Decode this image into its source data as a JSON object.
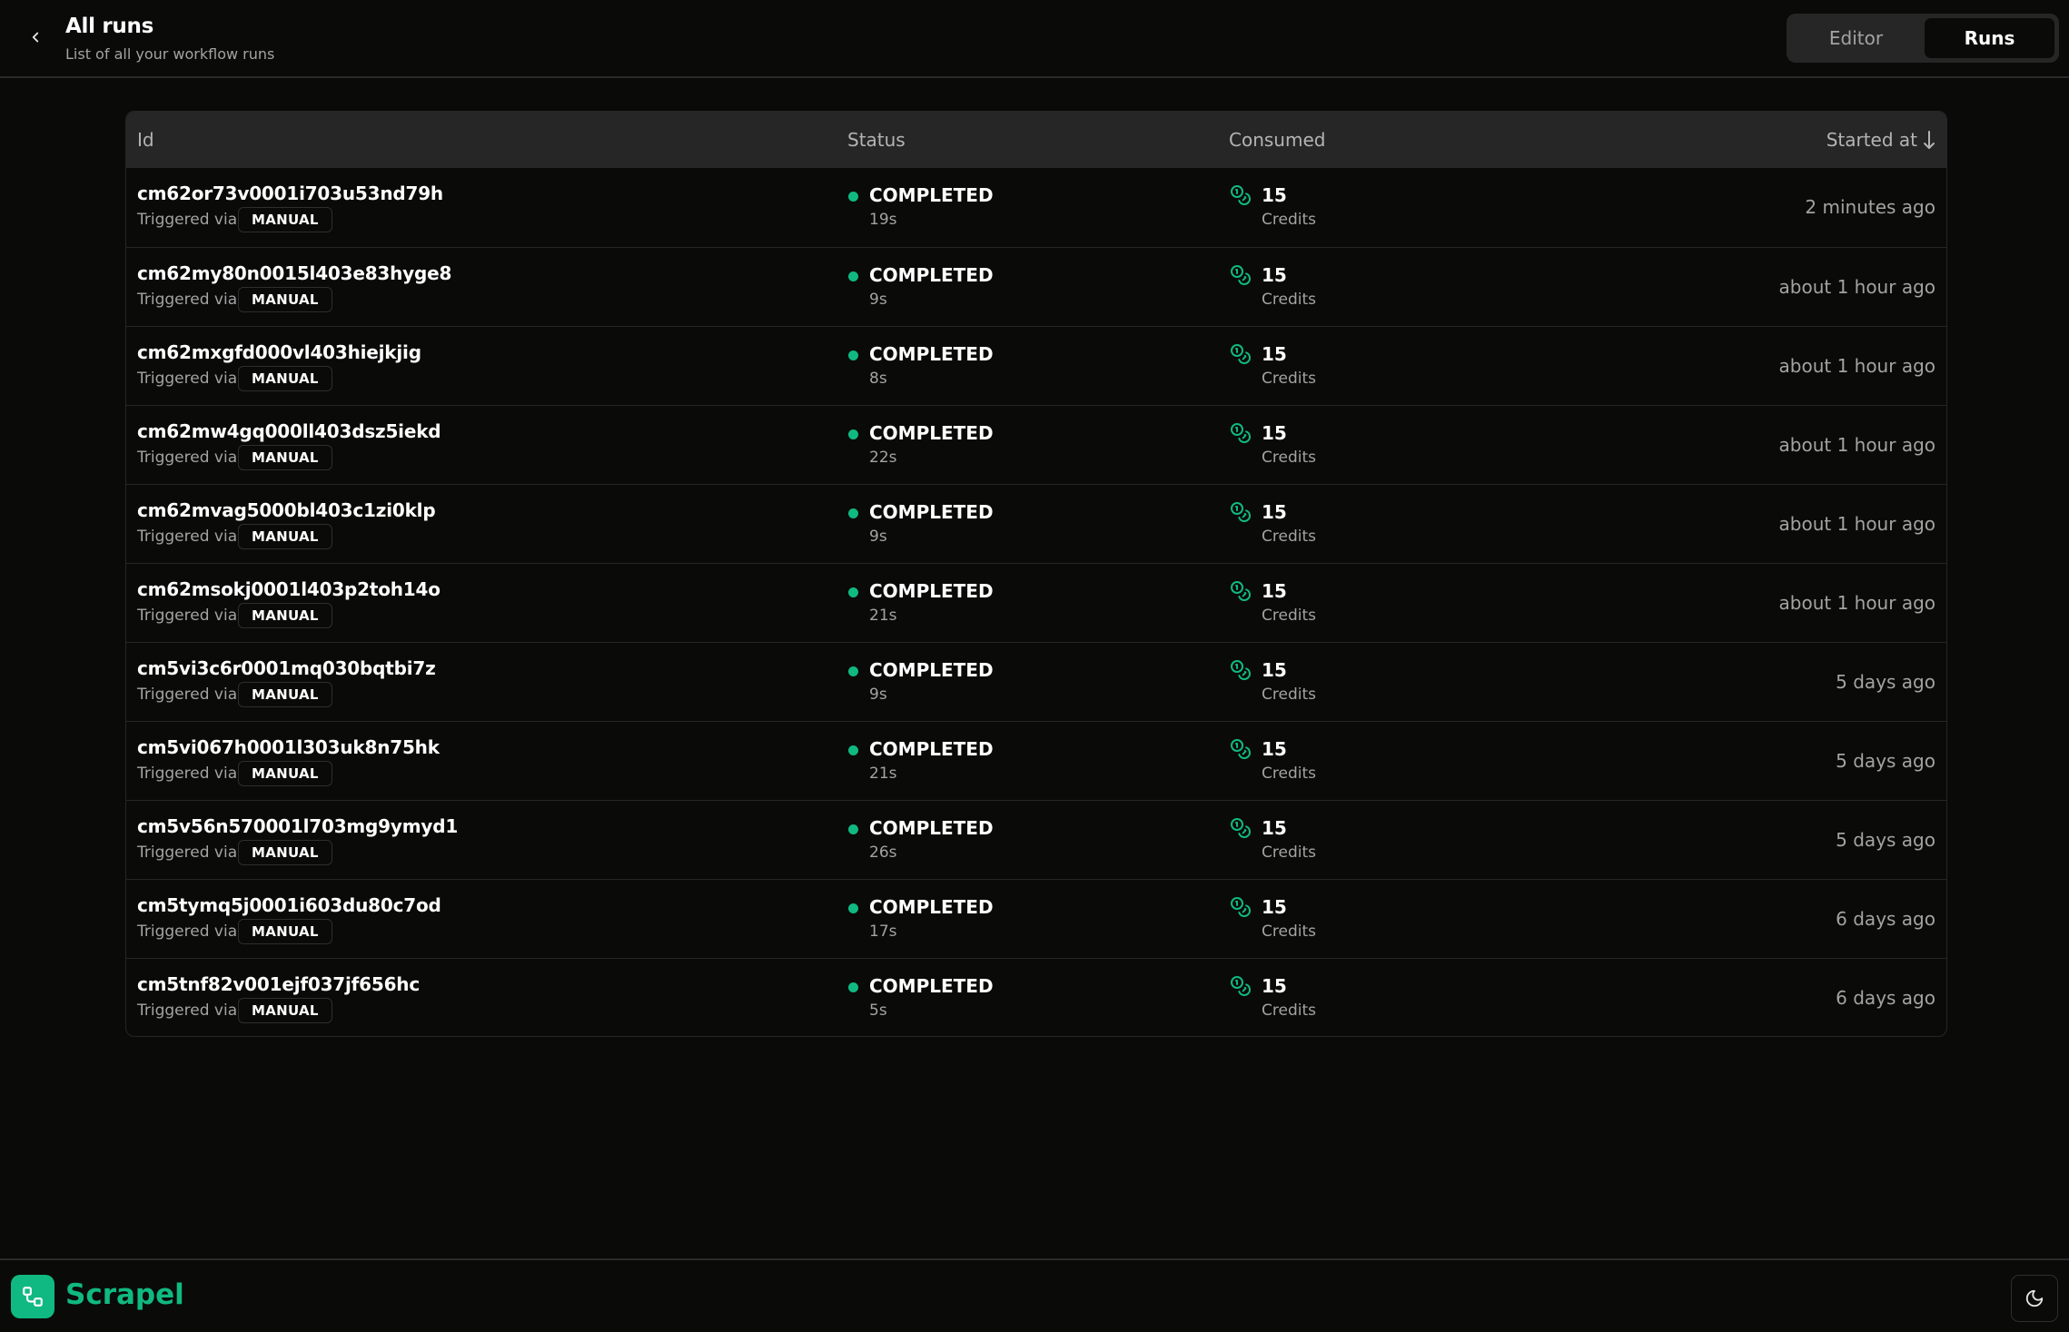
{
  "header": {
    "title": "All runs",
    "subtitle": "List of all your workflow runs",
    "back_icon": "chevron-left-icon",
    "tabs": [
      {
        "label": "Editor",
        "active": false
      },
      {
        "label": "Runs",
        "active": true
      }
    ]
  },
  "table": {
    "columns": {
      "id": "Id",
      "status": "Status",
      "consumed": "Consumed",
      "started_at": "Started at"
    },
    "sort_icon": "arrow-down-icon",
    "rows": [
      {
        "id": "cm62or73v0001i703u53nd79h",
        "trigger_label": "Triggered via",
        "trigger": "MANUAL",
        "status": "COMPLETED",
        "duration": "19s",
        "credits": "15",
        "credits_label": "Credits",
        "started": "2 minutes ago"
      },
      {
        "id": "cm62my80n0015l403e83hyge8",
        "trigger_label": "Triggered via",
        "trigger": "MANUAL",
        "status": "COMPLETED",
        "duration": "9s",
        "credits": "15",
        "credits_label": "Credits",
        "started": "about 1 hour ago"
      },
      {
        "id": "cm62mxgfd000vl403hiejkjig",
        "trigger_label": "Triggered via",
        "trigger": "MANUAL",
        "status": "COMPLETED",
        "duration": "8s",
        "credits": "15",
        "credits_label": "Credits",
        "started": "about 1 hour ago"
      },
      {
        "id": "cm62mw4gq000ll403dsz5iekd",
        "trigger_label": "Triggered via",
        "trigger": "MANUAL",
        "status": "COMPLETED",
        "duration": "22s",
        "credits": "15",
        "credits_label": "Credits",
        "started": "about 1 hour ago"
      },
      {
        "id": "cm62mvag5000bl403c1zi0klp",
        "trigger_label": "Triggered via",
        "trigger": "MANUAL",
        "status": "COMPLETED",
        "duration": "9s",
        "credits": "15",
        "credits_label": "Credits",
        "started": "about 1 hour ago"
      },
      {
        "id": "cm62msokj0001l403p2toh14o",
        "trigger_label": "Triggered via",
        "trigger": "MANUAL",
        "status": "COMPLETED",
        "duration": "21s",
        "credits": "15",
        "credits_label": "Credits",
        "started": "about 1 hour ago"
      },
      {
        "id": "cm5vi3c6r0001mq030bqtbi7z",
        "trigger_label": "Triggered via",
        "trigger": "MANUAL",
        "status": "COMPLETED",
        "duration": "9s",
        "credits": "15",
        "credits_label": "Credits",
        "started": "5 days ago"
      },
      {
        "id": "cm5vi067h0001l303uk8n75hk",
        "trigger_label": "Triggered via",
        "trigger": "MANUAL",
        "status": "COMPLETED",
        "duration": "21s",
        "credits": "15",
        "credits_label": "Credits",
        "started": "5 days ago"
      },
      {
        "id": "cm5v56n570001l703mg9ymyd1",
        "trigger_label": "Triggered via",
        "trigger": "MANUAL",
        "status": "COMPLETED",
        "duration": "26s",
        "credits": "15",
        "credits_label": "Credits",
        "started": "5 days ago"
      },
      {
        "id": "cm5tymq5j0001i603du80c7od",
        "trigger_label": "Triggered via",
        "trigger": "MANUAL",
        "status": "COMPLETED",
        "duration": "17s",
        "credits": "15",
        "credits_label": "Credits",
        "started": "6 days ago"
      },
      {
        "id": "cm5tnf82v001ejf037jf656hc",
        "trigger_label": "Triggered via",
        "trigger": "MANUAL",
        "status": "COMPLETED",
        "duration": "5s",
        "credits": "15",
        "credits_label": "Credits",
        "started": "6 days ago"
      }
    ]
  },
  "footer": {
    "brand": "Scrapel",
    "logo_icon": "workflow-icon",
    "theme_icon": "moon-icon"
  },
  "colors": {
    "accent": "#10b981",
    "background": "#0a0a09",
    "header_row": "#262626",
    "muted_text": "#a3a3a3"
  }
}
